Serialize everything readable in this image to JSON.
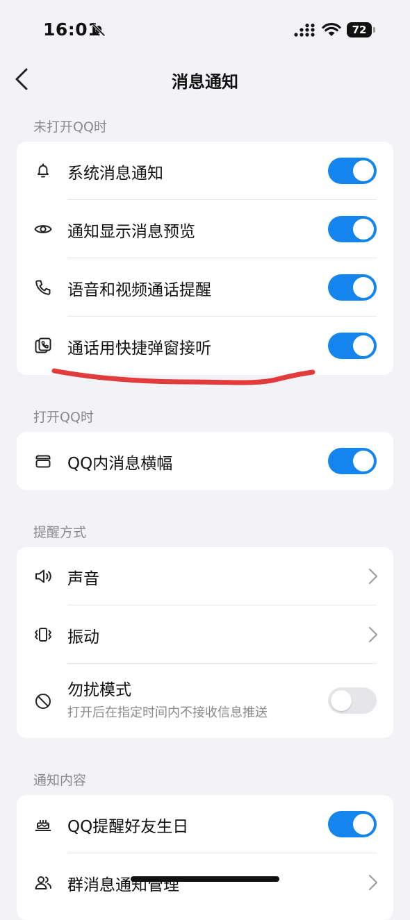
{
  "status": {
    "time": "16:01",
    "battery": "72"
  },
  "nav": {
    "title": "消息通知"
  },
  "sections": [
    {
      "title": "未打开QQ时"
    },
    {
      "title": "打开QQ时"
    },
    {
      "title": "提醒方式"
    },
    {
      "title": "通知内容"
    }
  ],
  "rows": {
    "system_notify": {
      "label": "系统消息通知",
      "on": true
    },
    "preview": {
      "label": "通知显示消息预览",
      "on": true
    },
    "call_remind": {
      "label": "语音和视频通话提醒",
      "on": true
    },
    "quick_answer": {
      "label": "通话用快捷弹窗接听",
      "on": true
    },
    "banner": {
      "label": "QQ内消息横幅",
      "on": true
    },
    "sound": {
      "label": "声音"
    },
    "vibrate": {
      "label": "振动"
    },
    "dnd": {
      "label": "勿扰模式",
      "sublabel": "打开后在指定时间内不接收信息推送",
      "on": false
    },
    "birthday": {
      "label": "QQ提醒好友生日",
      "on": true
    },
    "group_notify": {
      "label": "群消息通知管理"
    }
  },
  "colors": {
    "accent": "#1485ee",
    "annotation": "#e23b3b",
    "background": "#f2f2f7"
  },
  "icons": [
    "bell-slash-icon",
    "signal-icon",
    "wifi-icon",
    "battery-icon",
    "back-chevron-icon",
    "bell-icon",
    "eye-icon",
    "phone-icon",
    "call-window-icon",
    "banner-icon",
    "speaker-icon",
    "vibrate-icon",
    "no-disturb-icon",
    "cake-icon",
    "people-icon",
    "chevron-right-icon"
  ]
}
